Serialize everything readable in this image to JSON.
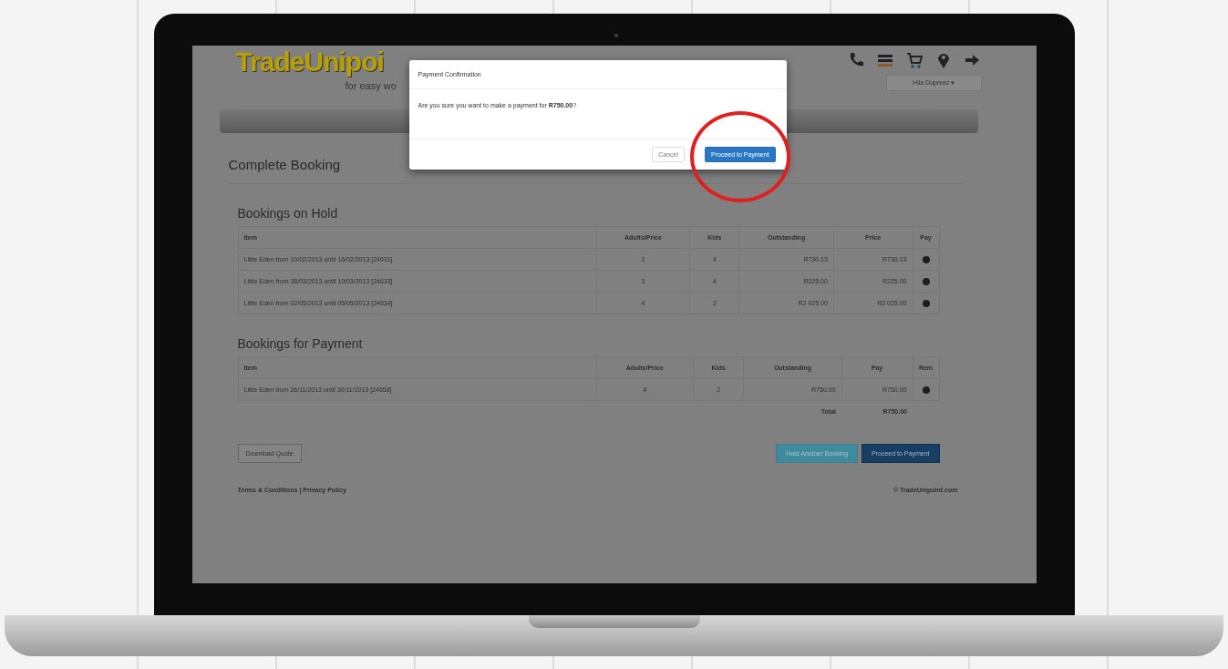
{
  "header": {
    "logo": "TradeUnipoi",
    "tagline": "for easy wo",
    "user_menu": "Hila Dupreez ▾"
  },
  "page_title": "Complete Booking",
  "hold": {
    "title": "Bookings on Hold",
    "columns": [
      "Item",
      "Adults/Price",
      "Kids",
      "Outstanding",
      "Price",
      "Pay"
    ],
    "rows": [
      {
        "item": "Little Eden from 10/02/2013 until 16/02/2013 [24631]",
        "adults": "2",
        "kids": "4",
        "outstanding": "R730.13",
        "price": "R730.13"
      },
      {
        "item": "Little Eden from 28/03/2013 until 10/03/2013 [24633]",
        "adults": "3",
        "kids": "4",
        "outstanding": "R225.00",
        "price": "R225.00"
      },
      {
        "item": "Little Eden from 02/05/2013 until 05/05/2013 [24634]",
        "adults": "4",
        "kids": "2",
        "outstanding": "R2 025.00",
        "price": "R2 025.00"
      }
    ]
  },
  "payment": {
    "title": "Bookings for Payment",
    "columns": [
      "Item",
      "Adults/Price",
      "Kids",
      "Outstanding",
      "Pay",
      "Rem"
    ],
    "rows": [
      {
        "item": "Little Eden from 26/11/2013 until 30/11/2013 [24658]",
        "adults": "4",
        "kids": "2",
        "outstanding": "R750.00",
        "pay": "R750.00"
      }
    ],
    "total_label": "Total",
    "total": "R750.00"
  },
  "buttons": {
    "download": "Download Quote",
    "hold_another": "Hold Another Booking",
    "proceed": "Proceed to Payment"
  },
  "footer": {
    "links": "Terms & Conditions | Privacy Policy",
    "copyright": "© TradeUnipoint.com"
  },
  "modal": {
    "title": "Payment Confirmation",
    "message": "Are you sure you want to make a payment for **R750.00**?",
    "cancel": "Cancel",
    "confirm": "Proceed to Payment"
  }
}
